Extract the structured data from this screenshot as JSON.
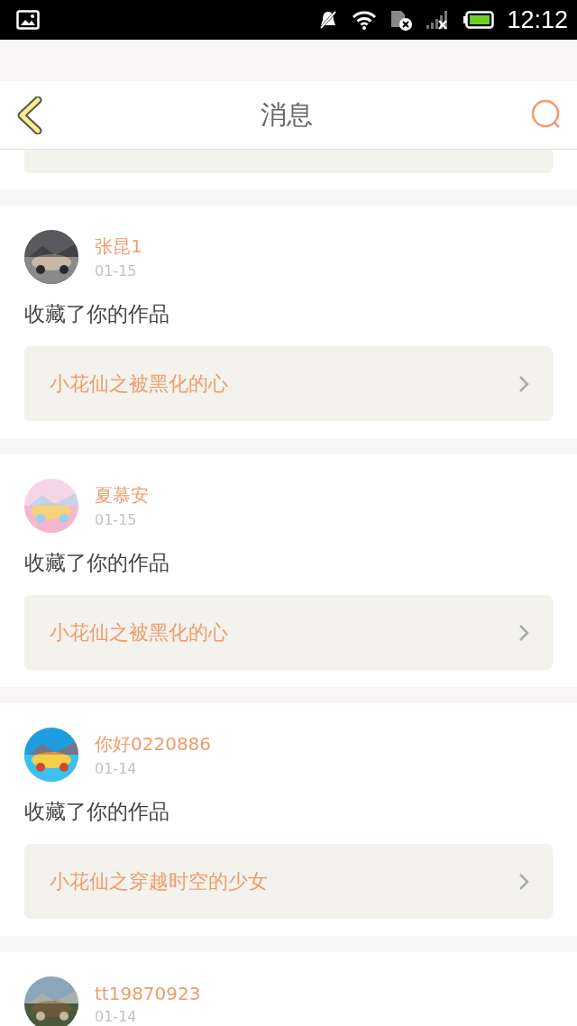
{
  "status_bar": {
    "time": "12:12"
  },
  "header": {
    "title": "消息"
  },
  "messages": [
    {
      "name": "张昆1",
      "date": "01-15",
      "action": "收藏了你的作品",
      "work": "小花仙之被黑化的心"
    },
    {
      "name": "夏慕安",
      "date": "01-15",
      "action": "收藏了你的作品",
      "work": "小花仙之被黑化的心"
    },
    {
      "name": "你好0220886",
      "date": "01-14",
      "action": "收藏了你的作品",
      "work": "小花仙之穿越时空的少女"
    },
    {
      "name": "tt19870923",
      "date": "01-14"
    }
  ]
}
